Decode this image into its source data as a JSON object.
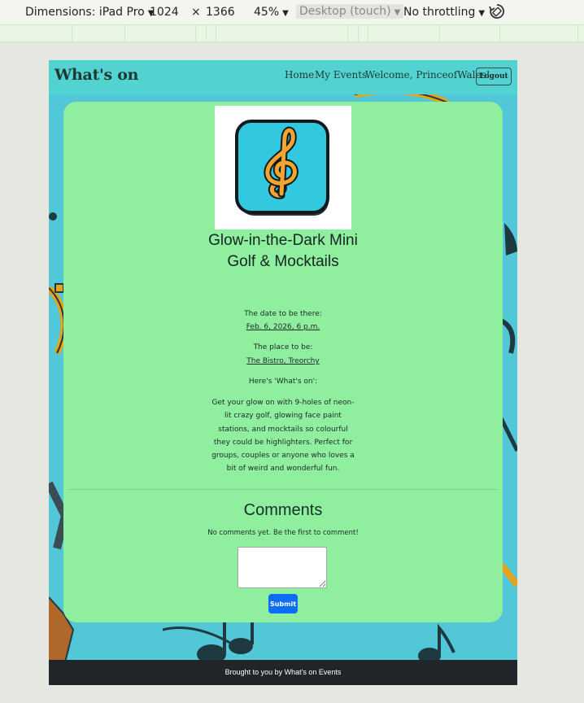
{
  "devtools": {
    "dimensions_label": "Dimensions: iPad Pro",
    "width": "1024",
    "times": "×",
    "height": "1366",
    "zoom": "45%",
    "device_type": "Desktop (touch)",
    "throttling": "No throttling"
  },
  "nav": {
    "brand": "What's on",
    "home": "Home",
    "my_events": "My Events",
    "welcome": "Welcome, PrinceofWales!",
    "logout": "Logout"
  },
  "event": {
    "title": "Glow-in-the-Dark Mini Golf & Mocktails",
    "date_label": "The date to be there:",
    "date_value": "Feb. 6, 2026, 6 p.m.",
    "place_label": "The place to be:",
    "place_value": "The Bistro, Treorchy",
    "whats_on_label": "Here's 'What's on':",
    "description": "Get your glow on with 9-holes of neon-lit crazy golf, glowing face paint stations, and mocktails so colourful they could be highlighters. Perfect for groups, couples or anyone who loves a bit of weird and wonderful fun.",
    "image_icon": "treble-clef-icon"
  },
  "comments": {
    "heading": "Comments",
    "empty_text": "No comments yet. Be the first to comment!",
    "textarea_value": "",
    "submit_label": "Submit"
  },
  "footer": {
    "text": "Brought to you by What's on Events"
  },
  "colors": {
    "navbar": "#52d3d1",
    "card": "#90ee9f",
    "page_background": "#52c7d8",
    "submit_button": "#0d6efd",
    "footer": "#212529"
  }
}
